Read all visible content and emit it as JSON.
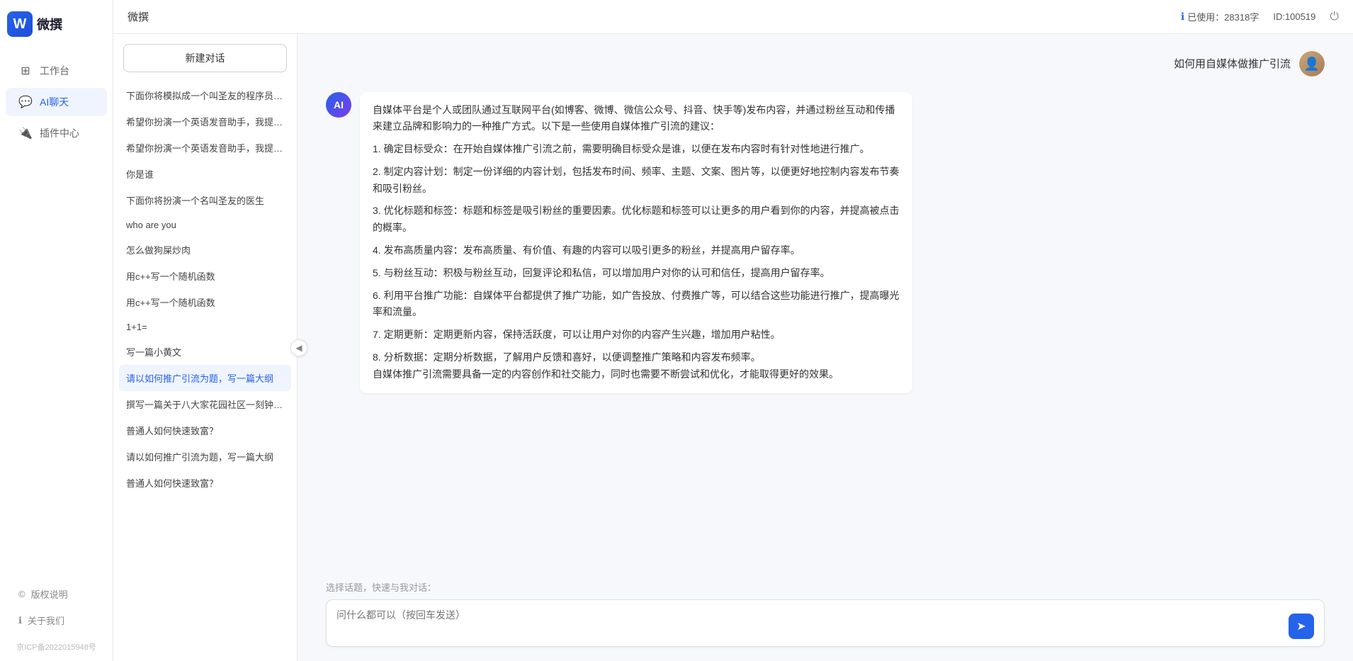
{
  "app": {
    "title": "微撰",
    "logo_letter": "W",
    "logo_text": "微撰"
  },
  "topbar": {
    "title": "微撰",
    "usage_label": "已使用：28318字",
    "id_label": "ID:100519",
    "info_icon": "ℹ"
  },
  "sidebar": {
    "nav_items": [
      {
        "id": "workbench",
        "label": "工作台",
        "icon": "⊞"
      },
      {
        "id": "ai-chat",
        "label": "AI聊天",
        "icon": "💬",
        "active": true
      },
      {
        "id": "plugin",
        "label": "插件中心",
        "icon": "🔌"
      }
    ],
    "bottom_items": [
      {
        "id": "copyright",
        "label": "版权说明",
        "icon": "©"
      },
      {
        "id": "about",
        "label": "关于我们",
        "icon": "ℹ"
      }
    ],
    "icp": "京ICP备2022015948号"
  },
  "history": {
    "new_chat_label": "新建对话",
    "items": [
      {
        "id": 1,
        "text": "下面你将模拟成一个叫圣友的程序员，我说...",
        "active": false
      },
      {
        "id": 2,
        "text": "希望你扮演一个英语发音助手，我提供给你...",
        "active": false
      },
      {
        "id": 3,
        "text": "希望你扮演一个英语发音助手，我提供给你...",
        "active": false
      },
      {
        "id": 4,
        "text": "你是谁",
        "active": false
      },
      {
        "id": 5,
        "text": "下面你将扮演一个名叫圣友的医生",
        "active": false
      },
      {
        "id": 6,
        "text": "who are you",
        "active": false
      },
      {
        "id": 7,
        "text": "怎么做狗屎炒肉",
        "active": false
      },
      {
        "id": 8,
        "text": "用c++写一个随机函数",
        "active": false
      },
      {
        "id": 9,
        "text": "用c++写一个随机函数",
        "active": false
      },
      {
        "id": 10,
        "text": "1+1=",
        "active": false
      },
      {
        "id": 11,
        "text": "写一篇小黄文",
        "active": false
      },
      {
        "id": 12,
        "text": "请以如何推广引流为题，写一篇大纲",
        "active": true
      },
      {
        "id": 13,
        "text": "撰写一篇关于八大家花园社区一刻钟便民生...",
        "active": false
      },
      {
        "id": 14,
        "text": "普通人如何快速致富？",
        "active": false
      },
      {
        "id": 15,
        "text": "请以如何推广引流为题，写一篇大纲",
        "active": false
      },
      {
        "id": 16,
        "text": "普通人如何快速致富？",
        "active": false
      }
    ]
  },
  "chat": {
    "user_question": "如何用自媒体做推广引流",
    "ai_response": {
      "intro": "自媒体平台是个人或团队通过互联网平台(如博客、微博、微信公众号、抖音、快手等)发布内容，并通过粉丝互动和传播来建立品牌和影响力的一种推广方式。以下是一些使用自媒体推广引流的建议：",
      "points": [
        "1. 确定目标受众：在开始自媒体推广引流之前，需要明确目标受众是谁，以便在发布内容时有针对性地进行推广。",
        "2. 制定内容计划：制定一份详细的内容计划，包括发布时间、频率、主题、文案、图片等，以便更好地控制内容发布节奏和吸引粉丝。",
        "3. 优化标题和标签：标题和标签是吸引粉丝的重要因素。优化标题和标签可以让更多的用户看到你的内容，并提高被点击的概率。",
        "4. 发布高质量内容：发布高质量、有价值、有趣的内容可以吸引更多的粉丝，并提高用户留存率。",
        "5. 与粉丝互动：积极与粉丝互动，回复评论和私信，可以增加用户对你的认可和信任，提高用户留存率。",
        "6. 利用平台推广功能：自媒体平台都提供了推广功能，如广告投放、付费推广等，可以结合这些功能进行推广，提高曝光率和流量。",
        "7. 定期更新：定期更新内容，保持活跃度，可以让用户对你的内容产生兴趣，增加用户粘性。",
        "8. 分析数据：定期分析数据，了解用户反馈和喜好，以便调整推广策略和内容发布频率。"
      ],
      "conclusion": "自媒体推广引流需要具备一定的内容创作和社交能力，同时也需要不断尝试和优化，才能取得更好的效果。"
    },
    "input_placeholder": "问什么都可以（按回车发送）",
    "quick_select_label": "选择话题，快速与我对话："
  },
  "colors": {
    "primary": "#2563eb",
    "ai_avatar_bg": "#2563eb",
    "active_nav": "#eff4ff",
    "active_nav_text": "#2563eb"
  }
}
